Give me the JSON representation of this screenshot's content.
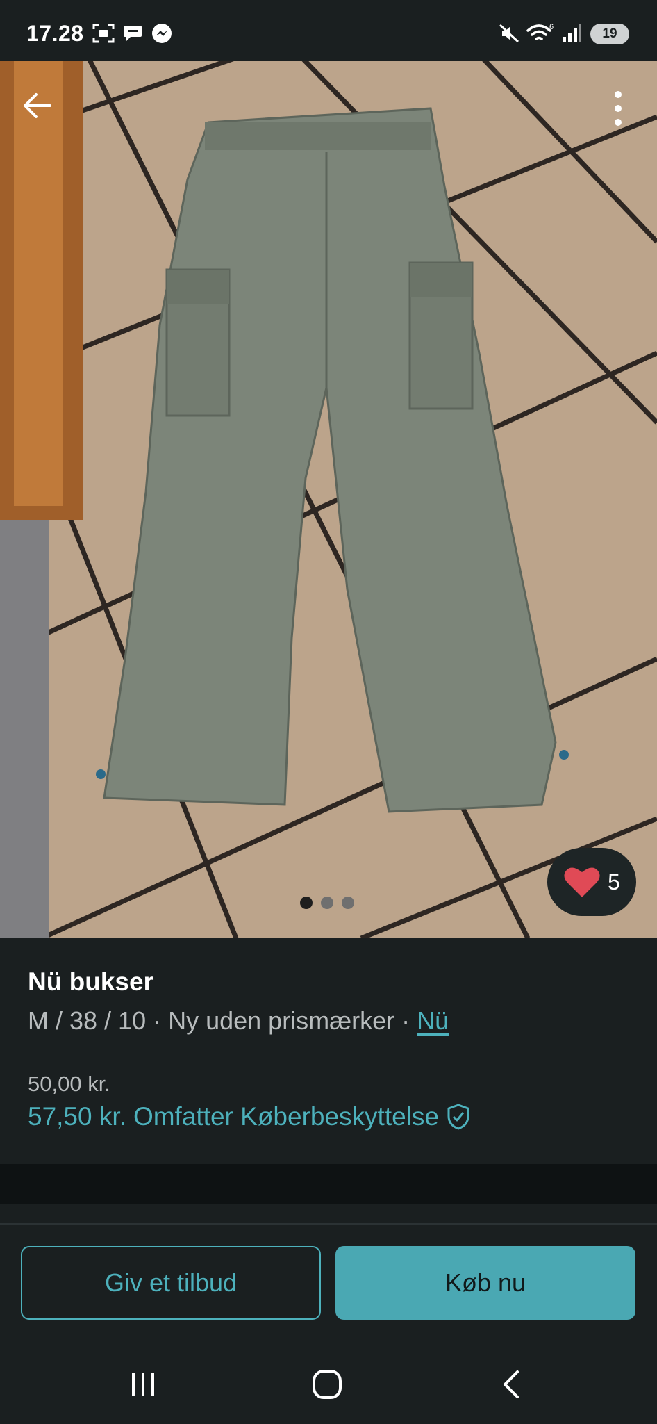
{
  "status_bar": {
    "time": "17.28",
    "battery": "19",
    "icons": [
      "screenshot-icon",
      "chat-bubble-icon",
      "messenger-icon",
      "mute-icon",
      "wifi-icon",
      "signal-icon"
    ]
  },
  "photo": {
    "icons": {
      "back": "arrow-left-icon",
      "more": "more-vertical-icon",
      "favorite": "heart-icon"
    },
    "page_count": 3,
    "active_page": 1,
    "favorites_count": "5"
  },
  "listing": {
    "title": "Nü bukser",
    "details": "M / 38 / 10 · Ny uden prismærker · ",
    "brand": "Nü",
    "price": "50,00 kr.",
    "price_total": "57,50 kr.",
    "protection_text": "Omfatter Køberbeskyttelse"
  },
  "actions": {
    "offer_label": "Giv et tilbud",
    "buy_label": "Køb nu"
  },
  "colors": {
    "accent": "#4db1bc",
    "button_fill": "#4aa8b3",
    "background": "#1a1f20",
    "heart": "#e04a56"
  },
  "nav_bar": {
    "icons": [
      "recents-icon",
      "home-icon",
      "back-icon"
    ]
  }
}
